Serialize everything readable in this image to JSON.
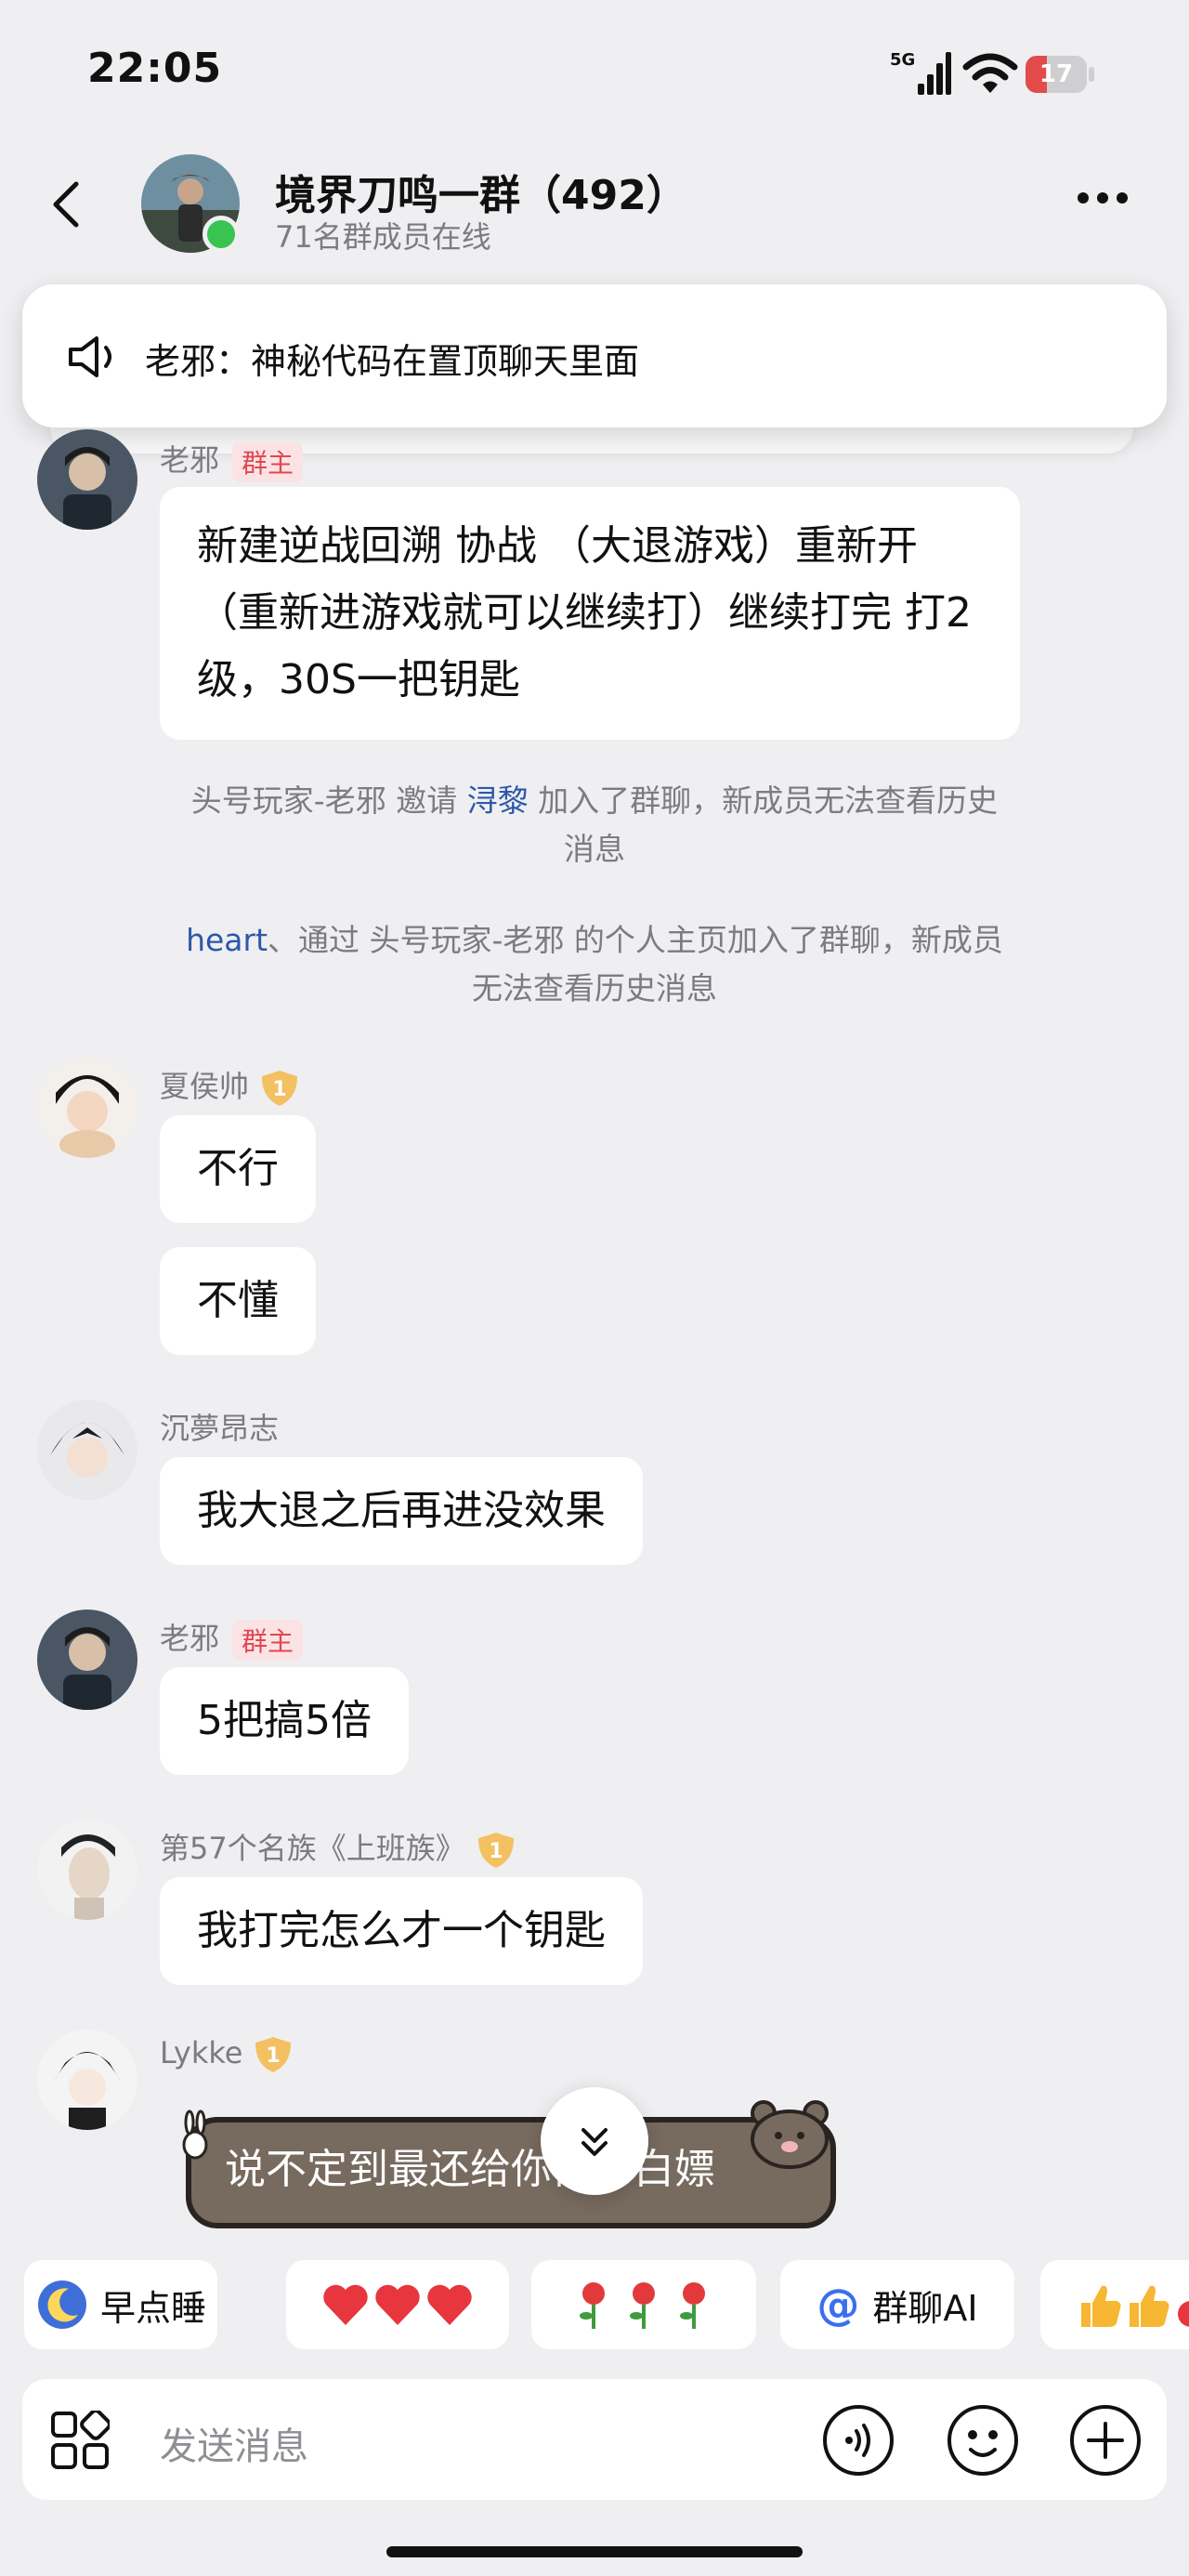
{
  "status": {
    "time": "22:05",
    "network": "5G",
    "battery": "17",
    "battery_fraction": 0.17
  },
  "header": {
    "title": "境界刀鸣一群（492）",
    "subtitle": "71名群成员在线"
  },
  "pinned": {
    "text": "老邪：神秘代码在置顶聊天里面"
  },
  "messages": {
    "m1": {
      "sender": "老邪",
      "badge": "群主",
      "text": "新建逆战回溯  协战  （大退游戏）重新开（重新进游戏就可以继续打）继续打完 打2级，30S一把钥匙"
    },
    "sys1": {
      "prefix": "头号玩家-老邪 邀请 ",
      "link": "浔黎",
      "suffix": " 加入了群聊，新成员无法查看历史消息"
    },
    "sys2": {
      "link": "heart",
      "suffix": "、通过 头号玩家-老邪 的个人主页加入了群聊，新成员无法查看历史消息"
    },
    "m2": {
      "sender": "夏侯帅",
      "level": "1",
      "text1": "不行",
      "text2": "不懂"
    },
    "m3": {
      "sender": "沉夢昂志",
      "text": "我大退之后再进没效果"
    },
    "m4": {
      "sender": "老邪",
      "badge": "群主",
      "text": "5把搞5倍"
    },
    "m5": {
      "sender": "第57个名族《上班族》",
      "level": "1",
      "text": "我打完怎么才一个钥匙"
    },
    "m6": {
      "sender": "Lykke",
      "level": "1",
      "sticker_text": "说不定到最还给你白，白嫖"
    }
  },
  "chips": {
    "sleep": "早点睡",
    "ai": "群聊AI"
  },
  "input": {
    "placeholder": "发送消息"
  },
  "colors": {
    "background": "#efeff1",
    "link": "#2c58a8",
    "owner_badge": "#e0474f",
    "online": "#39c452"
  }
}
